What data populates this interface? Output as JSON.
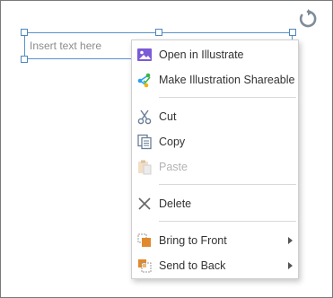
{
  "textbox": {
    "placeholder": "Insert text here"
  },
  "context_menu": {
    "items": [
      {
        "label": "Open in Illustrate",
        "icon": "illustrate-icon",
        "enabled": true
      },
      {
        "label": "Make Illustration Shareable",
        "icon": "share-network-icon",
        "enabled": true
      },
      {
        "label": "Cut",
        "icon": "scissors-icon",
        "enabled": true
      },
      {
        "label": "Copy",
        "icon": "copy-icon",
        "enabled": true
      },
      {
        "label": "Paste",
        "icon": "paste-icon",
        "enabled": false
      },
      {
        "label": "Delete",
        "icon": "delete-x-icon",
        "enabled": true
      },
      {
        "label": "Bring to Front",
        "icon": "bring-to-front-icon",
        "enabled": true,
        "submenu": true
      },
      {
        "label": "Send to Back",
        "icon": "send-to-back-icon",
        "enabled": true,
        "submenu": true
      }
    ]
  },
  "colors": {
    "selection_border": "#5b93c9",
    "accent_purple": "#7b5bd6",
    "accent_orange": "#e08a2d"
  }
}
